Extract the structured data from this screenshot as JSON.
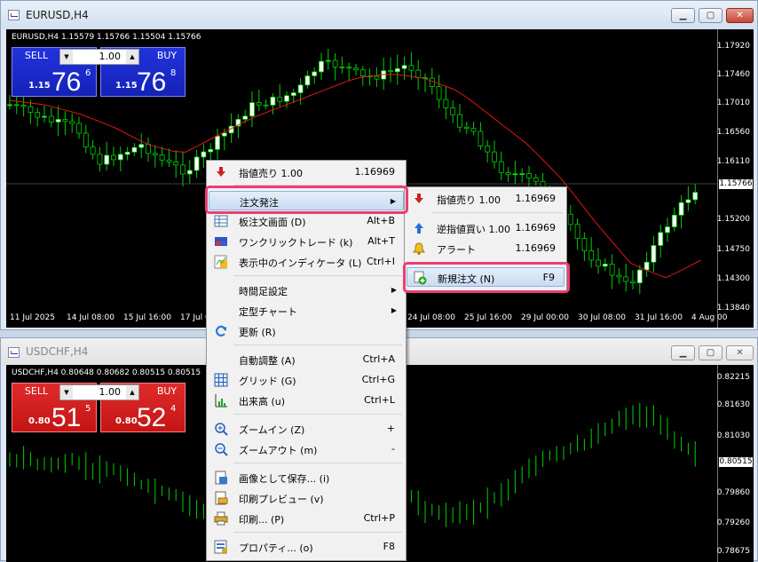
{
  "window1": {
    "title": "EURUSD,H4",
    "chart_header": "EURUSD,H4  1.15579 1.15766 1.15504 1.15766",
    "trade_panel": {
      "sell_label": "SELL",
      "buy_label": "BUY",
      "lots": "1.00",
      "sell_pre": "1.15",
      "sell_big": "76",
      "sell_sup": "6",
      "buy_pre": "1.15",
      "buy_big": "76",
      "buy_sup": "8"
    },
    "price_axis": [
      "1.17920",
      "1.17460",
      "1.17010",
      "1.16560",
      "1.16110",
      "1.15200",
      "1.14750",
      "1.14300",
      "1.13840"
    ],
    "current_price": "1.15766",
    "time_axis": [
      "11 Jul 2025",
      "14 Jul 08:00",
      "15 Jul 16:00",
      "17 Jul 0",
      "24 Jul 08:00",
      "25 Jul 16:00",
      "29 Jul 00:00",
      "30 Jul 08:00",
      "31 Jul 16:00",
      "4 Aug 00"
    ]
  },
  "window2": {
    "title": "USDCHF,H4",
    "chart_header": "USDCHF,H4  0.80648 0.80682 0.80515 0.80515",
    "trade_panel": {
      "sell_label": "SELL",
      "buy_label": "BUY",
      "lots": "1.00",
      "sell_pre": "0.80",
      "sell_big": "51",
      "sell_sup": "5",
      "buy_pre": "0.80",
      "buy_big": "52",
      "buy_sup": "4"
    },
    "price_axis": [
      "0.82215",
      "0.81630",
      "0.81030",
      "0.79860",
      "0.79260",
      "0.78675"
    ],
    "current_price": "0.80515"
  },
  "context_menu": {
    "items": [
      {
        "label": "指値売り 1.00",
        "shortcut": "1.16969",
        "icon": "sell-arrow-icon"
      },
      {
        "label": "注文発注",
        "shortcut": "",
        "icon": "",
        "submenu": true
      },
      {
        "label": "板注文画面 (D)",
        "shortcut": "Alt+B",
        "icon": "depth-of-market-icon"
      },
      {
        "label": "ワンクリックトレード (k)",
        "shortcut": "Alt+T",
        "icon": "one-click-trading-icon"
      },
      {
        "label": "表示中のインディケータ (L)",
        "shortcut": "Ctrl+I",
        "icon": "indicators-list-icon"
      },
      {
        "label": "時間足設定",
        "shortcut": "",
        "icon": "",
        "submenu": true
      },
      {
        "label": "定型チャート",
        "shortcut": "",
        "icon": "",
        "submenu": true
      },
      {
        "label": "更新 (R)",
        "shortcut": "",
        "icon": "refresh-icon"
      },
      {
        "label": "自動調整 (A)",
        "shortcut": "Ctrl+A",
        "icon": ""
      },
      {
        "label": "グリッド (G)",
        "shortcut": "Ctrl+G",
        "icon": "grid-icon"
      },
      {
        "label": "出来高 (u)",
        "shortcut": "Ctrl+L",
        "icon": "volumes-icon"
      },
      {
        "label": "ズームイン (Z)",
        "shortcut": "+",
        "icon": "zoom-in-icon"
      },
      {
        "label": "ズームアウト (m)",
        "shortcut": "-",
        "icon": "zoom-out-icon"
      },
      {
        "label": "画像として保存... (i)",
        "shortcut": "",
        "icon": "save-picture-icon"
      },
      {
        "label": "印刷プレビュー (v)",
        "shortcut": "",
        "icon": "print-preview-icon"
      },
      {
        "label": "印刷... (P)",
        "shortcut": "Ctrl+P",
        "icon": "print-icon"
      },
      {
        "label": "プロパティ... (o)",
        "shortcut": "F8",
        "icon": "properties-icon"
      }
    ]
  },
  "submenu": {
    "items": [
      {
        "label": "指値売り 1.00",
        "shortcut": "1.16969",
        "icon": "sell-arrow-icon"
      },
      {
        "label": "逆指値買い 1.00",
        "shortcut": "1.16969",
        "icon": "buy-arrow-icon"
      },
      {
        "label": "アラート",
        "shortcut": "1.16969",
        "icon": "alert-bell-icon"
      },
      {
        "label": "新規注文 (N)",
        "shortcut": "F9",
        "icon": "new-order-icon"
      }
    ]
  },
  "colors": {
    "bull": "#ffffff",
    "bear": "#000000",
    "candle_green": "#00e000",
    "ma_red": "#e01818",
    "highlight": "#ec3d73"
  }
}
